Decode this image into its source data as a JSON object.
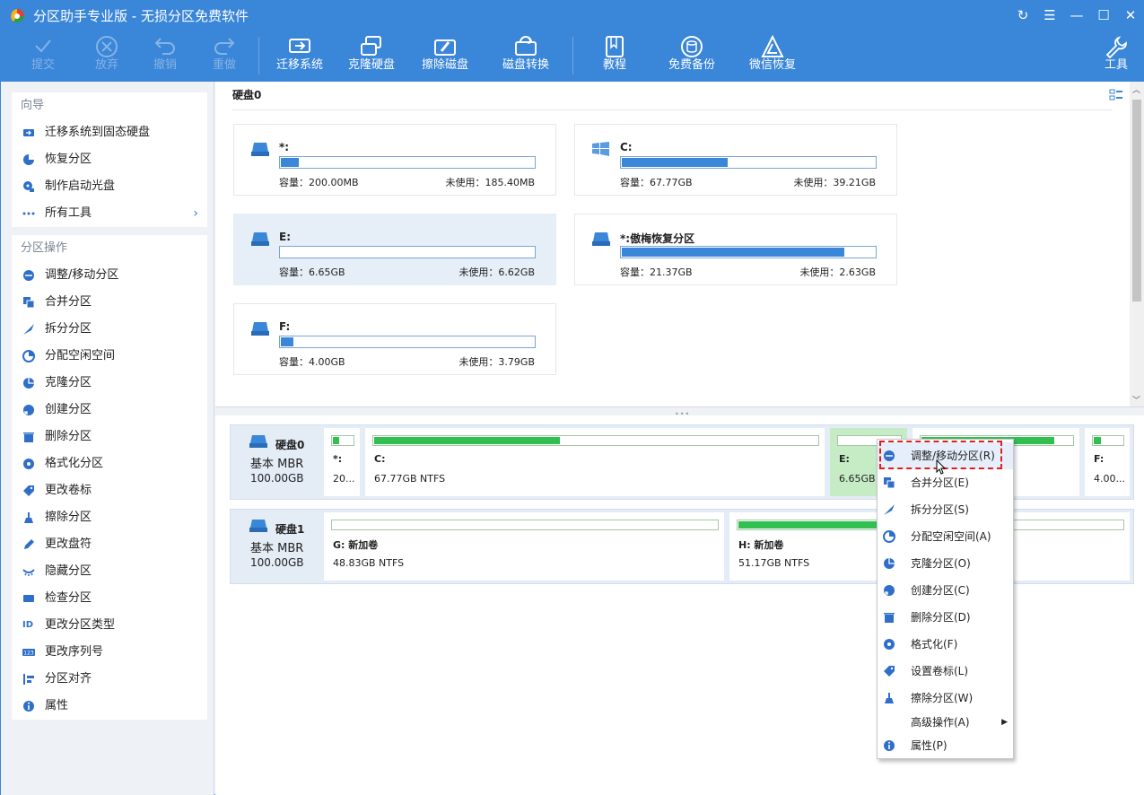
{
  "window": {
    "title": "分区助手专业版 - 无损分区免费软件",
    "controls": [
      "↻",
      "☰",
      "—",
      "☐",
      "✕"
    ]
  },
  "toolbar": {
    "commit": "提交",
    "discard": "放弃",
    "undo": "撤销",
    "redo": "重做",
    "migrate": "迁移系统",
    "clone": "克隆硬盘",
    "wipe": "擦除磁盘",
    "convert": "磁盘转换",
    "tutorial": "教程",
    "backup": "免费备份",
    "wechat": "微信恢复",
    "tools": "工具"
  },
  "sidebar": {
    "wizard_title": "向导",
    "wizard": [
      "迁移系统到固态硬盘",
      "恢复分区",
      "制作启动光盘",
      "所有工具"
    ],
    "ops_title": "分区操作",
    "ops": [
      "调整/移动分区",
      "合并分区",
      "拆分分区",
      "分配空闲空间",
      "克隆分区",
      "创建分区",
      "删除分区",
      "格式化分区",
      "更改卷标",
      "擦除分区",
      "更改盘符",
      "隐藏分区",
      "检查分区",
      "更改分区类型",
      "更改序列号",
      "分区对齐",
      "属性"
    ]
  },
  "disk0_title": "硬盘0",
  "cards": [
    {
      "name": "*:",
      "cap": "容量：200.00MB",
      "free": "未使用：185.40MB",
      "used_pct": 7
    },
    {
      "name": "C:",
      "cap": "容量：67.77GB",
      "free": "未使用：39.21GB",
      "used_pct": 42
    },
    {
      "name": "E:",
      "cap": "容量：6.65GB",
      "free": "未使用：6.62GB",
      "used_pct": 0
    },
    {
      "name": "*:傲梅恢复分区",
      "cap": "容量：21.37GB",
      "free": "未使用：2.63GB",
      "used_pct": 88
    },
    {
      "name": "F:",
      "cap": "容量：4.00GB",
      "free": "未使用：3.79GB",
      "used_pct": 5
    }
  ],
  "disks": [
    {
      "name": "硬盘0",
      "type": "基本 MBR",
      "size": "100.00GB",
      "parts": [
        {
          "label": "*:",
          "info": "20...",
          "used_pct": 30
        },
        {
          "label": "C:",
          "info": "67.77GB NTFS",
          "used_pct": 42
        },
        {
          "label": "E:",
          "info": "6.65GB NTFS",
          "used_pct": 0
        },
        {
          "label": "",
          "info": "",
          "used_pct": 88
        },
        {
          "label": "F:",
          "info": "4.00...",
          "used_pct": 25
        }
      ]
    },
    {
      "name": "硬盘1",
      "type": "基本 MBR",
      "size": "100.00GB",
      "parts": [
        {
          "label": "G: 新加卷",
          "info": "48.83GB NTFS",
          "used_pct": 0
        },
        {
          "label": "H: 新加卷",
          "info": "51.17GB NTFS",
          "used_pct": 37
        }
      ]
    }
  ],
  "context_menu": [
    "调整/移动分区(R)",
    "合并分区(E)",
    "拆分分区(S)",
    "分配空闲空间(A)",
    "克隆分区(O)",
    "创建分区(C)",
    "删除分区(D)",
    "格式化(F)",
    "设置卷标(L)",
    "擦除分区(W)",
    "高级操作(A)",
    "属性(P)"
  ],
  "colors": {
    "accent": "#3a86d8",
    "used": "#30c050",
    "highlight": "#e0201c"
  }
}
